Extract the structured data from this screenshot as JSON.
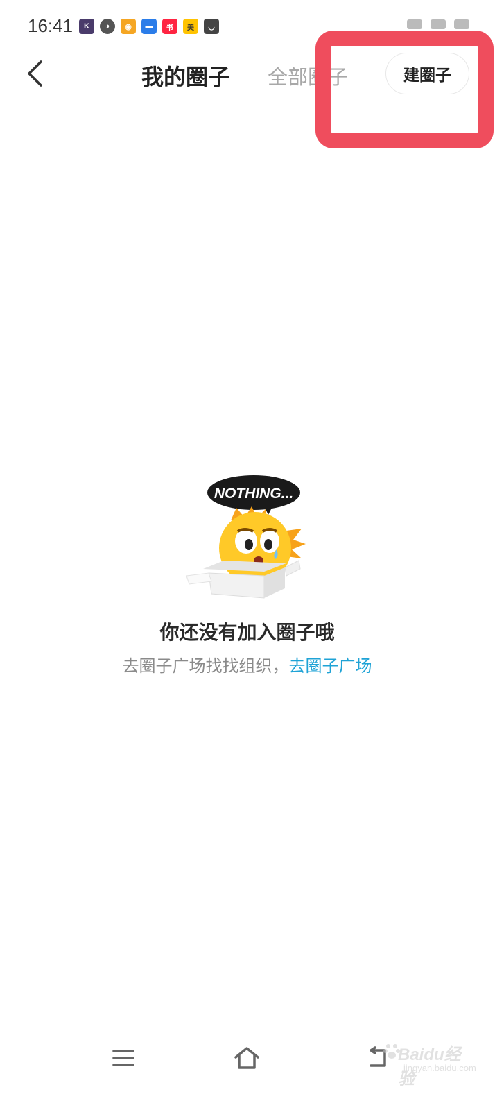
{
  "status_bar": {
    "time": "16:41",
    "notification_icons": [
      {
        "name": "k-app-icon",
        "glyph": "K",
        "color": "#4a3b6b"
      },
      {
        "name": "compass-app-icon",
        "glyph": "◑",
        "color": "#555555"
      },
      {
        "name": "weibo-icon",
        "glyph": "◉",
        "color": "#f5a623"
      },
      {
        "name": "car-app-icon",
        "glyph": "▬",
        "color": "#2b7de9"
      },
      {
        "name": "xiaohongshu-icon",
        "glyph": "书",
        "color": "#ff2442"
      },
      {
        "name": "meituan-icon",
        "glyph": "美",
        "color": "#ffc300"
      },
      {
        "name": "bag-app-icon",
        "glyph": "◡",
        "color": "#444444"
      }
    ]
  },
  "header": {
    "tab_mine": "我的圈子",
    "tab_all": "全部圈子",
    "create_button": "建圈子"
  },
  "empty_state": {
    "bubble_text": "NOTHING...",
    "title": "你还没有加入圈子哦",
    "subtitle_prefix": "去圈子广场找找组织，",
    "subtitle_link": "去圈子广场"
  },
  "watermark": {
    "text": "Baidu经验",
    "sub": "jingyan.baidu.com"
  },
  "colors": {
    "highlight": "#ef4d5d",
    "link": "#1fa3d6",
    "mascot": "#ffc928"
  }
}
